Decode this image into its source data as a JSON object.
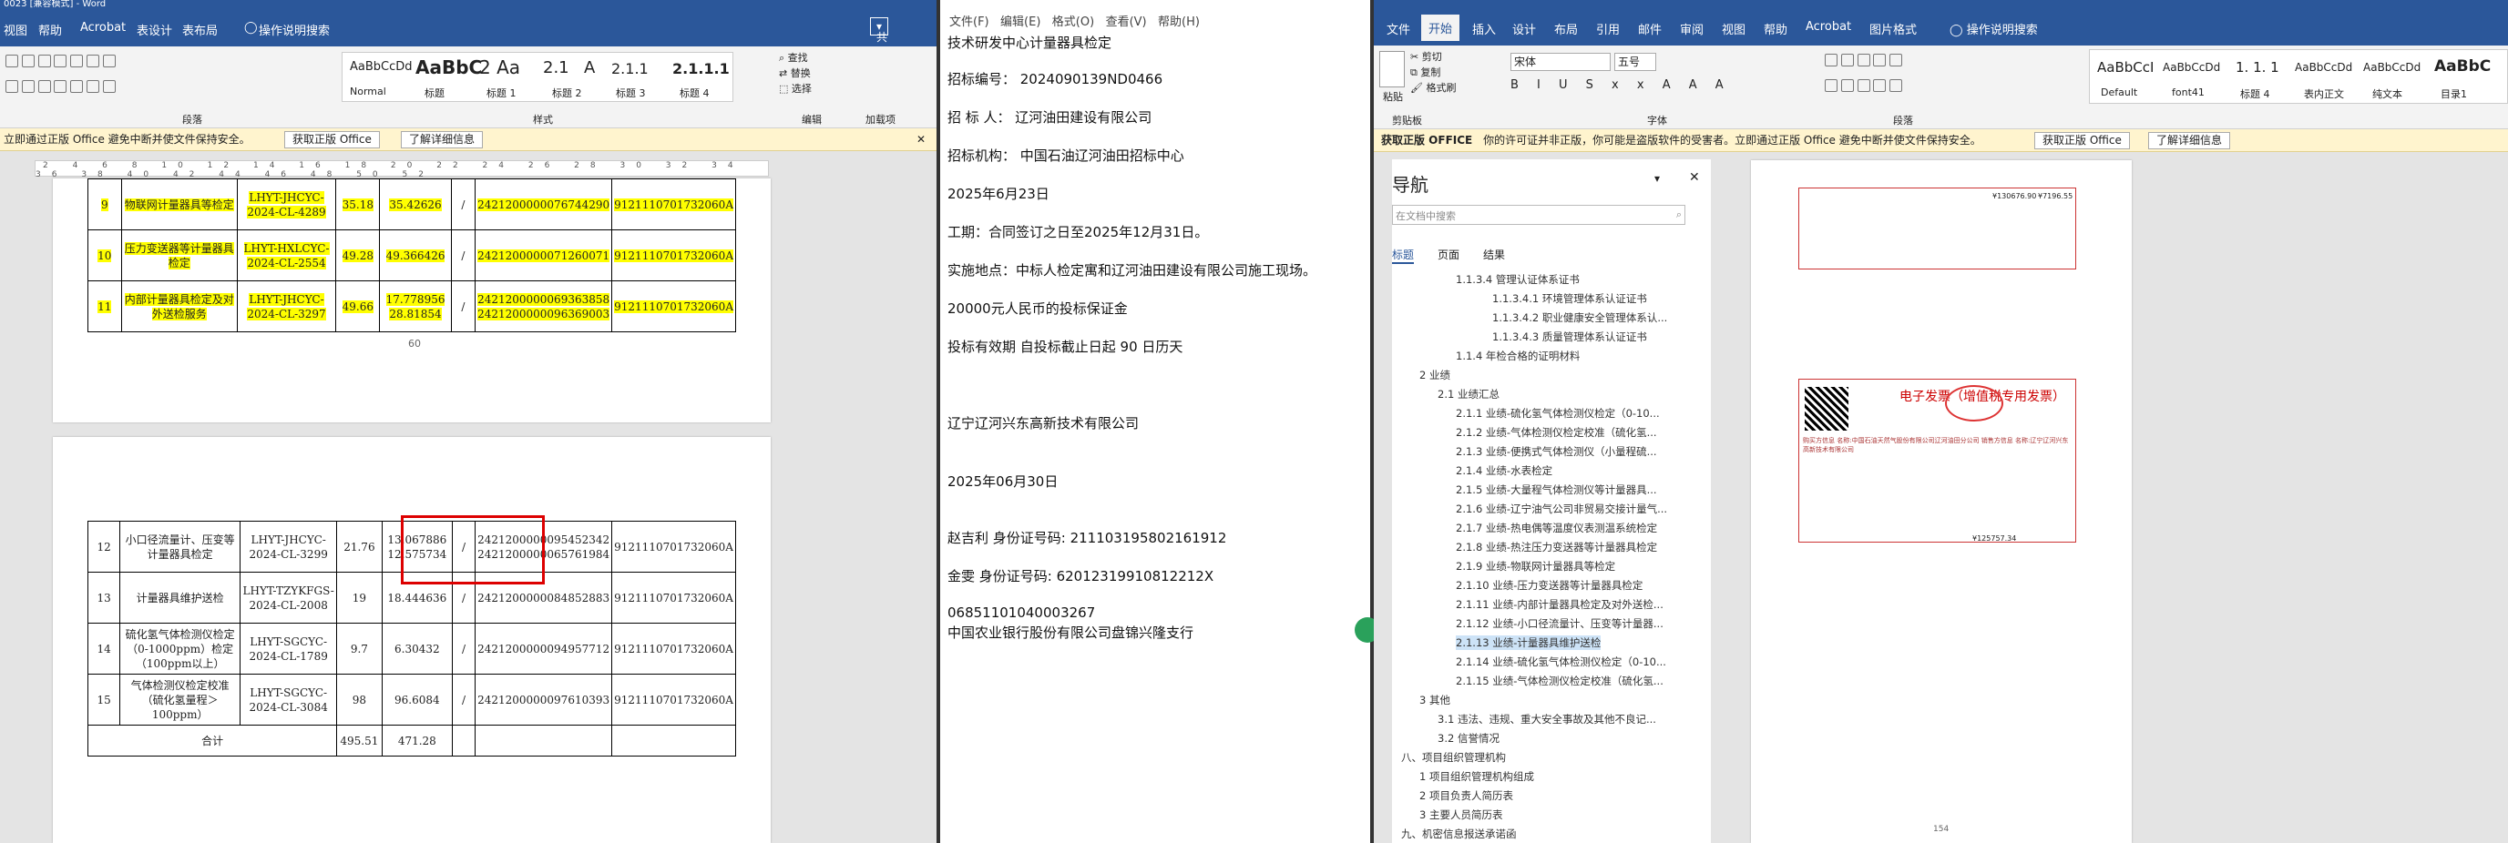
{
  "left": {
    "title": "0023 [兼容模式] - Word",
    "tabs": [
      "视图",
      "帮助",
      "Acrobat",
      "表设计",
      "表布局",
      "操作说明搜索"
    ],
    "share": "共享",
    "styles": [
      "AaBbCcDd",
      "AaBbC",
      "2 Aa",
      "2.1",
      "A",
      "2.1.1",
      "2.1.1.1"
    ],
    "style_names": [
      "Normal",
      "标题",
      "标题 1",
      "标题 2",
      "标题 3",
      "标题 4"
    ],
    "editing": [
      "查找",
      "替换",
      "选择"
    ],
    "groups": [
      "段落",
      "样式",
      "编辑",
      "加载项"
    ],
    "msg": "立即通过正版 Office 避免中断并使文件保持安全。",
    "btn1": "获取正版 Office",
    "btn2": "了解详细信息",
    "ruler": "2 4 6 8 10 12 14 16 18 20 22 24 26 28 30 32 34 36 38 40 42 44 46 48 50 52",
    "page_num": "60",
    "rows_top": [
      {
        "n": "9",
        "name": "物联网计量器具等检定",
        "code": "LHYT-JHCYC-2024-CL-4289",
        "a": "35.18",
        "b": "35.42626",
        "c": "/",
        "d": "2421200000076744290",
        "e": "9121110701732060A"
      },
      {
        "n": "10",
        "name": "压力变送器等计量器具检定",
        "code": "LHYT-HXLCYC-2024-CL-2554",
        "a": "49.28",
        "b": "49.366426",
        "c": "/",
        "d": "2421200000071260071",
        "e": "9121110701732060A"
      },
      {
        "n": "11",
        "name": "内部计量器具检定及对外送检服务",
        "code": "LHYT-JHCYC-2024-CL-3297",
        "a": "49.66",
        "b": "17.778956 28.81854",
        "c": "/",
        "d": "2421200000069363858 2421200000096369003",
        "e": "9121110701732060A"
      }
    ],
    "rows_bot": [
      {
        "n": "12",
        "name": "小口径流量计、压变等计量器具检定",
        "code": "LHYT-JHCYC-2024-CL-3299",
        "a": "21.76",
        "b": "13.067886 12.575734",
        "c": "/",
        "d": "2421200000095452342 2421200000065761984",
        "e": "9121110701732060A"
      },
      {
        "n": "13",
        "name": "计量器具维护送检",
        "code": "LHYT-TZYKFGS-2024-CL-2008",
        "a": "19",
        "b": "18.444636",
        "c": "/",
        "d": "2421200000084852883",
        "e": "9121110701732060A"
      },
      {
        "n": "14",
        "name": "硫化氢气体检测仪检定（0-1000ppm）检定（100ppm以上）",
        "code": "LHYT-SGCYC-2024-CL-1789",
        "a": "9.7",
        "b": "6.30432",
        "c": "/",
        "d": "2421200000094957712",
        "e": "9121110701732060A"
      },
      {
        "n": "15",
        "name": "气体检测仪检定校准（硫化氢量程＞100ppm）",
        "code": "LHYT-SGCYC-2024-CL-3084",
        "a": "98",
        "b": "96.6084",
        "c": "/",
        "d": "2421200000097610393",
        "e": "9121110701732060A"
      }
    ],
    "total_label": "合计",
    "total_a": "495.51",
    "total_b": "471.28"
  },
  "notepad": {
    "menu": [
      "文件(F)",
      "编辑(E)",
      "格式(O)",
      "查看(V)",
      "帮助(H)"
    ],
    "lines": [
      "技术研发中心计量器具检定",
      "招标编号：  2024090139ND0466",
      "招 标 人：  辽河油田建设有限公司",
      "招标机构：  中国石油辽河油田招标中心",
      "2025年6月23日",
      "工期：合同签订之日至2025年12月31日。",
      "实施地点：中标人检定寓和辽河油田建设有限公司施工现场。",
      "20000元人民币的投标保证金",
      "投标有效期  自投标截止日起  90   日历天",
      "辽宁辽河兴东高新技术有限公司",
      "2025年06月30日",
      "赵吉利  身份证号码:      211103195802161912",
      "金雯      身份证号码:      62012319910812212X",
      "06851101040003267",
      "中国农业银行股份有限公司盘锦兴隆支行"
    ]
  },
  "right": {
    "tabs": [
      "文件",
      "开始",
      "插入",
      "设计",
      "布局",
      "引用",
      "邮件",
      "审阅",
      "视图",
      "帮助",
      "Acrobat",
      "图片格式",
      "操作说明搜索"
    ],
    "clip": [
      "剪切",
      "复制",
      "格式刷",
      "粘贴",
      "剪贴板"
    ],
    "font": "宋体",
    "size": "五号",
    "font_group": "字体",
    "para_group": "段落",
    "styles": [
      "AaBbCcI",
      "AaBbCcDd",
      "1. 1. 1",
      "AaBbCcDd",
      "AaBbCcDd",
      "AaBbC"
    ],
    "style_names": [
      "Default",
      "font41",
      "标题 4",
      "表内正文",
      "纯文本",
      "目录1"
    ],
    "msg_label": "获取正版 OFFICE",
    "msg": "你的许可证并非正版，你可能是盗版软件的受害者。立即通过正版 Office 避免中断并使文件保持安全。",
    "btn1": "获取正版 Office",
    "btn2": "了解详细信息",
    "nav_title": "导航",
    "search_ph": "在文档中搜索",
    "nav_tabs": [
      "标题",
      "页面",
      "结果"
    ],
    "nav_items": [
      "1.1.3.4 管理认证体系证书",
      "1.1.3.4.1 环境管理体系认证证书",
      "1.1.3.4.2 职业健康安全管理体系认...",
      "1.1.3.4.3 质量管理体系认证证书",
      "1.1.4 年检合格的证明材料",
      "2 业绩",
      "2.1 业绩汇总",
      "2.1.1 业绩-硫化氢气体检测仪检定（0-10...",
      "2.1.2 业绩-气体检测仪检定校准（硫化氢...",
      "2.1.3 业绩-便携式气体检测仪（小量程硫...",
      "2.1.4 业绩-水表检定",
      "2.1.5 业绩-大量程气体检测仪等计量器具...",
      "2.1.6 业绩-辽宁油气公司非贸易交接计量气...",
      "2.1.7 业绩-热电偶等温度仪表测温系统检定",
      "2.1.8 业绩-热注压力变送器等计量器具检定",
      "2.1.9 业绩-物联网计量器具等检定",
      "2.1.10 业绩-压力变送器等计量器具检定",
      "2.1.11 业绩-内部计量器具检定及对外送检...",
      "2.1.12 业绩-小口径流量计、压变等计量器...",
      "2.1.13 业绩-计量器具维护送检",
      "2.1.14 业绩-硫化氢气体检测仪检定（0-10...",
      "2.1.15 业绩-气体检测仪检定校准（硫化氢...",
      "3 其他",
      "3.1 违法、违规、重大安全事故及其他不良记...",
      "3.2 信誉情况",
      "八、项目组织管理机构",
      "1 项目组织管理机构组成",
      "2 项目负责人简历表",
      "3 主要人员简历表",
      "九、机密信息报送承诺函"
    ],
    "invoice_title": "电子发票（增值税专用发票）",
    "invoice_text": "购买方信息 名称:中国石油天然气股份有限公司辽河油田分公司 销售方信息 名称:辽宁辽河兴东高新技术有限公司",
    "amount1": "¥130676.90",
    "amount2": "¥7196.55",
    "amount3": "¥125757.34",
    "page2": "154"
  }
}
